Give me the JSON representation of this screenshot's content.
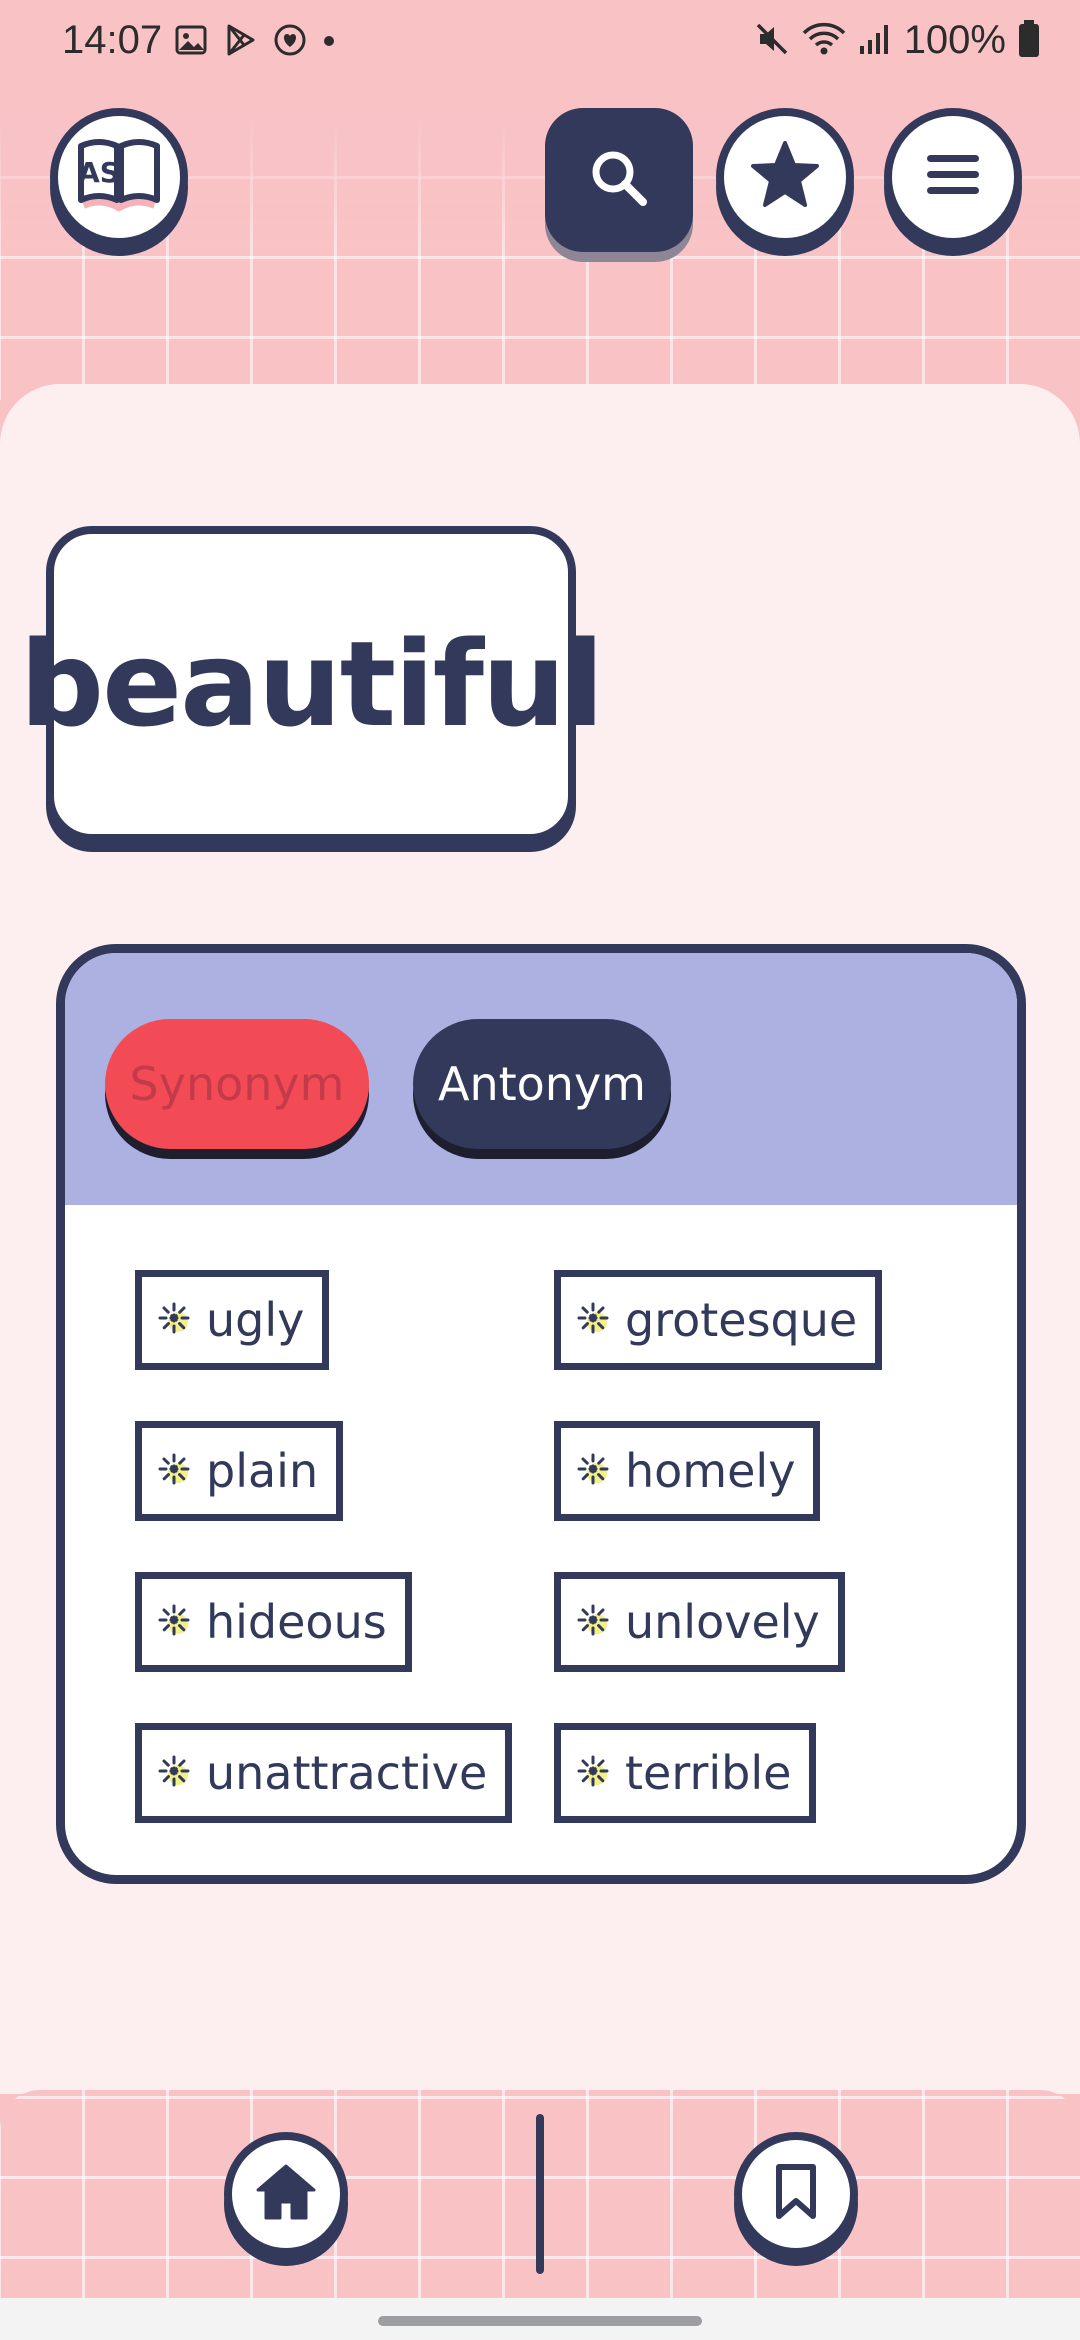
{
  "status_bar": {
    "time": "14:07",
    "battery": "100%"
  },
  "app": {
    "logo_letters": "AS"
  },
  "word": "beautiful",
  "tabs": [
    {
      "label": "Synonym",
      "active": false
    },
    {
      "label": "Antonym",
      "active": true
    }
  ],
  "results": [
    "ugly",
    "grotesque",
    "plain",
    "homely",
    "hideous",
    "unlovely",
    "unattractive",
    "terrible"
  ],
  "colors": {
    "primary": "#33395a",
    "background": "#f9c3c6",
    "panel": "#fdeff0",
    "tab_header": "#adb1e2",
    "synonym_tab": "#f24b56",
    "spark_yellow": "#f2f088"
  },
  "icons": {
    "logo": "book-as-icon",
    "search": "search-icon",
    "favorites": "star-icon",
    "menu": "hamburger-menu-icon",
    "home": "home-icon",
    "bookmark": "bookmark-icon",
    "chip_marker": "sparkle-icon"
  }
}
